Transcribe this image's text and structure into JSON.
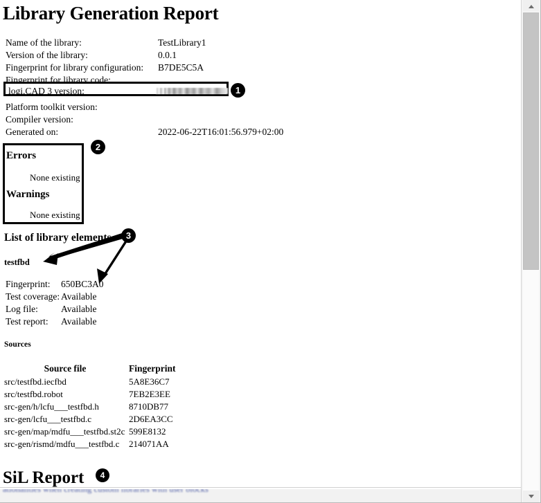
{
  "document": {
    "title": "Library Generation Report",
    "info": [
      {
        "label": "Name of the library:",
        "value": "TestLibrary1"
      },
      {
        "label": "Version of the library:",
        "value": "0.0.1"
      },
      {
        "label": "Fingerprint for library configuration:",
        "value": "B7DE5C5A"
      },
      {
        "label": "Fingerprint for library code:",
        "value": ""
      },
      {
        "label": "Platform toolkit version:",
        "value": ""
      },
      {
        "label": "Compiler version:",
        "value": ""
      },
      {
        "label": "Generated on:",
        "value": "2022-06-22T16:01:56.979+02:00"
      }
    ],
    "highlighted_row": {
      "label": "logi.CAD 3 version:",
      "value": "",
      "value_state": "redacted"
    },
    "diagnostics": {
      "errors_heading": "Errors",
      "errors_text": "None existing",
      "warnings_heading": "Warnings",
      "warnings_text": "None existing"
    },
    "library_elements": {
      "heading": "List of library elements",
      "element_name": "testfbd",
      "properties": [
        {
          "key": "Fingerprint:",
          "value": "650BC3A0"
        },
        {
          "key": "Test coverage:",
          "value": "Available"
        },
        {
          "key": "Log file:",
          "value": "Available"
        },
        {
          "key": "Test report:",
          "value": "Available"
        }
      ],
      "sources_heading": "Sources",
      "sources_table": {
        "columns": [
          "Source file",
          "Fingerprint"
        ],
        "rows": [
          [
            "src/testfbd.iecfbd",
            "5A8E36C7"
          ],
          [
            "src/testfbd.robot",
            "7EB2E3EE"
          ],
          [
            "src-gen/h/lcfu___testfbd.h",
            "8710DB77"
          ],
          [
            "src-gen/lcfu___testfbd.c",
            "2D6EA3CC"
          ],
          [
            "src-gen/map/mdfu___testfbd.st2c",
            "599E8132"
          ],
          [
            "src-gen/rismd/mdfu___testfbd.c",
            "214071AA"
          ]
        ]
      }
    },
    "sil_report_title": "SiL Report",
    "bottom_link_text": "ationalities when creating custom libraries with user blocks"
  },
  "callouts": [
    {
      "number": "1"
    },
    {
      "number": "2"
    },
    {
      "number": "3"
    },
    {
      "number": "4"
    }
  ],
  "scrollbar": {
    "up_icon": "triangle-up-icon",
    "down_icon": "triangle-down-icon",
    "thumb": "scroll-thumb"
  },
  "colors": {
    "text": "#000000",
    "callout_bg": "#000000",
    "callout_fg": "#ffffff",
    "link": "#3b4a9c",
    "scrollbar_thumb": "#c4c4c4"
  }
}
